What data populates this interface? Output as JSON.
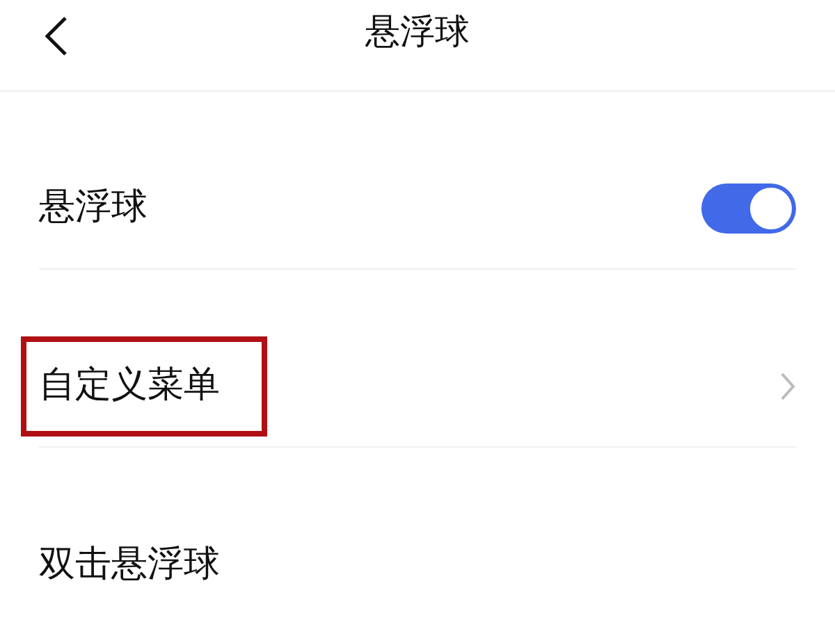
{
  "header": {
    "title": "悬浮球"
  },
  "items": [
    {
      "kind": "toggle",
      "label": "悬浮球",
      "on": true,
      "highlighted": false
    },
    {
      "kind": "link",
      "label": "自定义菜单",
      "highlighted": true
    },
    {
      "kind": "plain",
      "label": "双击悬浮球",
      "highlighted": false
    }
  ]
}
